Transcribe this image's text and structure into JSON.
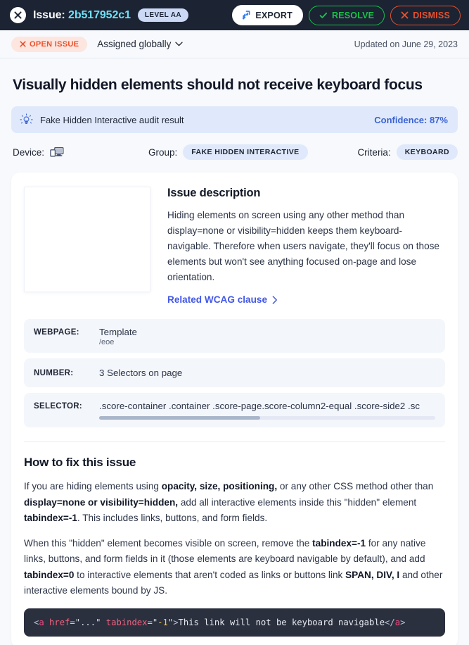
{
  "topbar": {
    "close_label": "close-issue",
    "title_prefix": "Issue:",
    "issue_id": "2b517952c1",
    "level_badge": "LEVEL AA",
    "export_label": "EXPORT",
    "resolve_label": "RESOLVE",
    "dismiss_label": "DISMISS"
  },
  "subbar": {
    "status_label": "OPEN ISSUE",
    "assignment_label": "Assigned globally",
    "updated_label": "Updated on June 29, 2023"
  },
  "page": {
    "title": "Visually hidden elements should not receive keyboard focus"
  },
  "banner": {
    "text": "Fake Hidden Interactive audit result",
    "confidence": "Confidence: 87%",
    "accent_color": "#3b63d4",
    "background_color": "#dfe9fb"
  },
  "meta": {
    "device_label": "Device:",
    "group_label": "Group:",
    "group_value": "FAKE HIDDEN INTERACTIVE",
    "criteria_label": "Criteria:",
    "criteria_value": "KEYBOARD"
  },
  "description": {
    "heading": "Issue description",
    "body": "Hiding elements on screen using any other method than display=none or visibility=hidden keeps them keyboard-navigable. Therefore when users navigate, they'll focus on those elements but won't see anything focused on-page and lose orientation.",
    "link_label": "Related WCAG clause"
  },
  "info": {
    "webpage_key": "WEBPAGE:",
    "webpage_value": "Template",
    "webpage_path": "/eoe",
    "number_key": "NUMBER:",
    "number_value": "3 Selectors on page",
    "selector_key": "SELECTOR:",
    "selector_value": ".score-container .container .score-page.score-column2-equal .score-side2 .sc"
  },
  "fix": {
    "heading": "How to fix this issue",
    "p1_a": "If you are hiding elements using ",
    "p1_b": "opacity, size, positioning,",
    "p1_c": " or any other CSS method other than ",
    "p1_d": "display=none or visibility=hidden,",
    "p1_e": " add all interactive elements inside this \"hidden\" element ",
    "p1_f": "tabindex=-1",
    "p1_g": ". This includes links, buttons, and form fields.",
    "p2_a": "When this \"hidden\" element becomes visible on screen, remove the ",
    "p2_b": "tabindex=-1",
    "p2_c": " for any native links, buttons, and form fields in it (those elements are keyboard navigable by default), and add ",
    "p2_d": "tabindex=0",
    "p2_e": " to interactive elements that aren't coded as links or buttons link ",
    "p2_f": "SPAN, DIV, I",
    "p2_g": " and other interactive elements bound by JS."
  },
  "code": {
    "open_bracket": "<",
    "tag": "a",
    "attr1": "href",
    "eq1": "=",
    "val1": "\"...\"",
    "space": " ",
    "attr2": "tabindex",
    "eq2": "=",
    "quote_open": "\"",
    "num": "-1",
    "quote_close": "\"",
    "close_bracket": ">",
    "text": "This link will not be keyboard navigable",
    "close_open": "</",
    "close_tag": "a",
    "close_end": ">"
  }
}
